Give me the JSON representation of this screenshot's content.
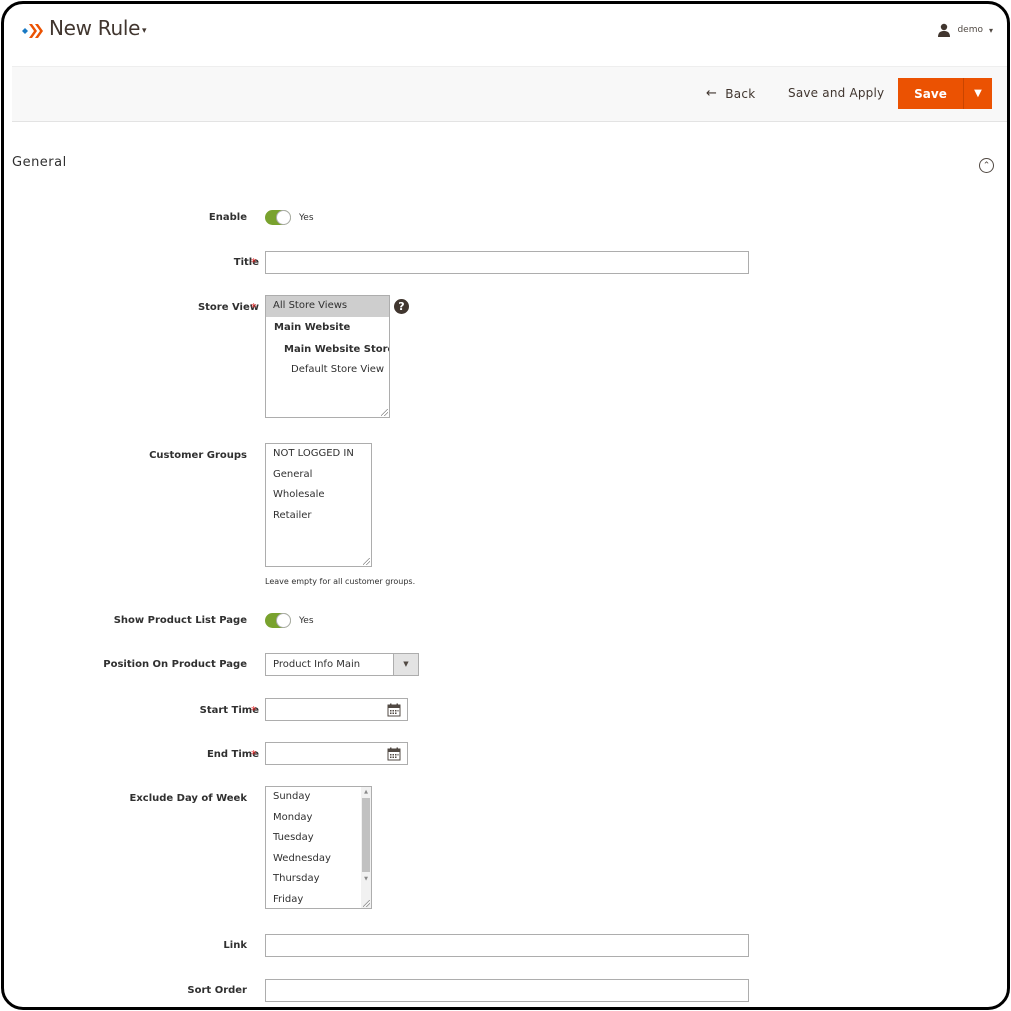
{
  "header": {
    "title": "New Rule",
    "title_caret": "▾",
    "user_name": "demo",
    "user_caret": "▾"
  },
  "actions": {
    "back_label": "Back",
    "back_arrow": "←",
    "save_apply_label": "Save and Apply",
    "save_label": "Save",
    "save_split_icon": "▼"
  },
  "colors": {
    "primary": "#eb5202",
    "toggle_on": "#79a22e",
    "required": "#e22626"
  },
  "section": {
    "title": "General",
    "collapse_icon": "⌃"
  },
  "form": {
    "enable": {
      "label": "Enable",
      "value": "Yes",
      "on": true
    },
    "title": {
      "label": "Title",
      "required": "*",
      "value": ""
    },
    "store_view": {
      "label": "Store View",
      "required": "*",
      "help": "?",
      "options": [
        {
          "label": "All Store Views",
          "selected": true
        },
        {
          "label": "Main Website",
          "selected": false
        },
        {
          "label": "Main Website Store",
          "selected": false
        },
        {
          "label": "Default Store View",
          "selected": false
        }
      ]
    },
    "customer_groups": {
      "label": "Customer Groups",
      "options": [
        "NOT LOGGED IN",
        "General",
        "Wholesale",
        "Retailer"
      ],
      "note": "Leave empty for all customer groups."
    },
    "show_product_list": {
      "label": "Show Product List Page",
      "value": "Yes",
      "on": true
    },
    "position": {
      "label": "Position On Product Page",
      "value": "Product Info Main",
      "arrow": "▼"
    },
    "start_time": {
      "label": "Start Time",
      "required": "*",
      "value": ""
    },
    "end_time": {
      "label": "End Time",
      "required": "*",
      "value": ""
    },
    "exclude_days": {
      "label": "Exclude Day of Week",
      "options": [
        "Sunday",
        "Monday",
        "Tuesday",
        "Wednesday",
        "Thursday",
        "Friday"
      ],
      "scroll_up": "▲",
      "scroll_down": "▼"
    },
    "link": {
      "label": "Link",
      "value": ""
    },
    "sort_order": {
      "label": "Sort Order",
      "value": ""
    }
  }
}
